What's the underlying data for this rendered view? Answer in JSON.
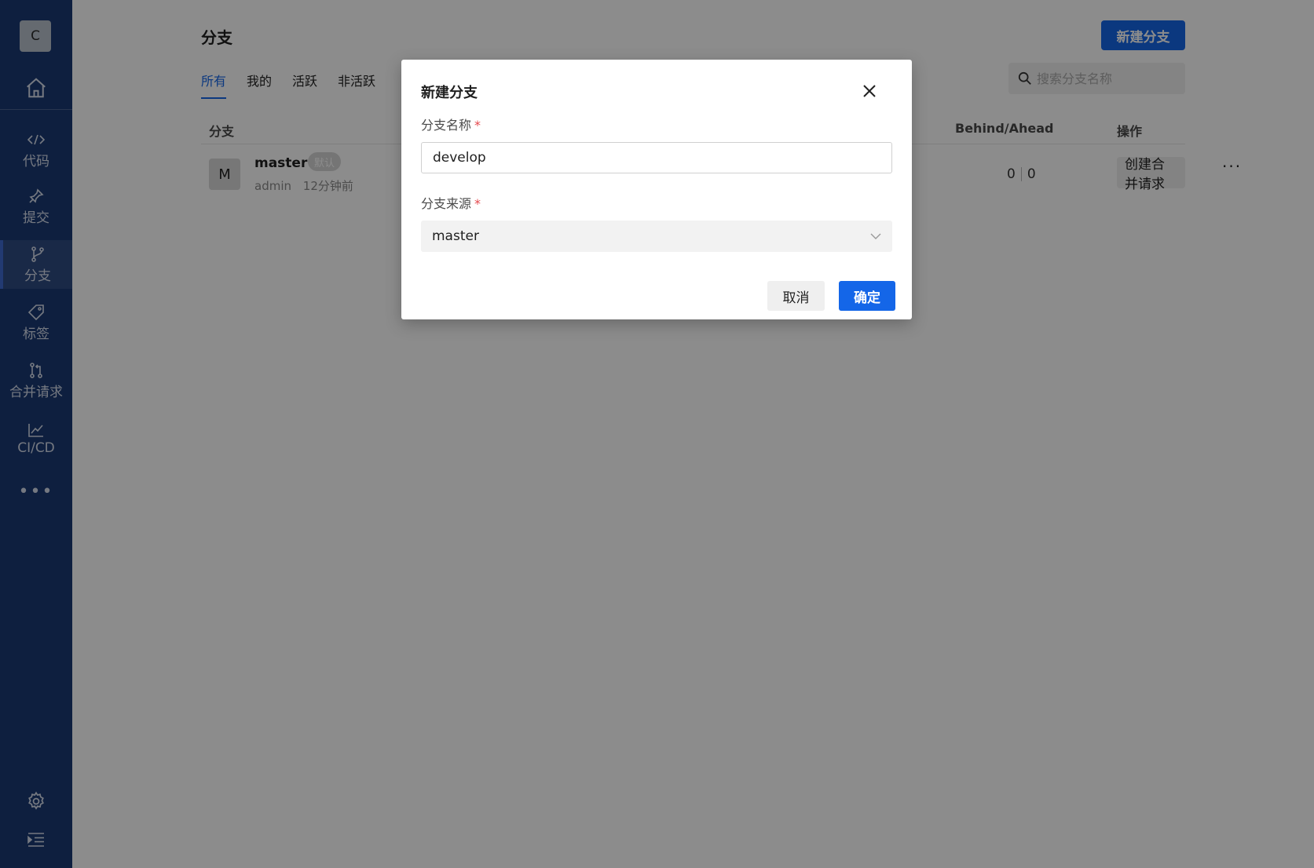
{
  "sidebar": {
    "avatar_letter": "C",
    "home_icon": "home-icon",
    "items": [
      {
        "label": "代码",
        "icon": "code-icon"
      },
      {
        "label": "提交",
        "icon": "pin-icon"
      },
      {
        "label": "分支",
        "icon": "branch-icon",
        "active": true
      },
      {
        "label": "标签",
        "icon": "tag-icon"
      },
      {
        "label": "合并请求",
        "icon": "merge-request-icon"
      },
      {
        "label": "CI/CD",
        "icon": "chart-line-icon"
      }
    ],
    "more": "•••",
    "bottom_icons": [
      "gear-icon",
      "collapse-menu-icon"
    ]
  },
  "page": {
    "title": "分支",
    "new_branch_button": "新建分支",
    "tabs": [
      {
        "label": "所有",
        "active": true
      },
      {
        "label": "我的"
      },
      {
        "label": "活跃"
      },
      {
        "label": "非活跃"
      }
    ],
    "search_placeholder": "搜索分支名称",
    "table": {
      "headers": {
        "branch": "分支",
        "behind_ahead": "Behind/Ahead",
        "actions": "操作"
      },
      "rows": [
        {
          "avatar": "M",
          "name": "master",
          "badge": "默认",
          "author": "admin",
          "time": "12分钟前",
          "behind": "0",
          "ahead": "0",
          "action": "创建合并请求",
          "more": "···"
        }
      ]
    }
  },
  "dialog": {
    "title": "新建分支",
    "name_label": "分支名称",
    "name_value": "develop",
    "source_label": "分支来源",
    "source_value": "master",
    "required_mark": "*",
    "cancel": "取消",
    "confirm": "确定"
  },
  "colors": {
    "sidebar_bg": "#1a3a73",
    "primary": "#1466e8",
    "required": "#e5484d"
  }
}
